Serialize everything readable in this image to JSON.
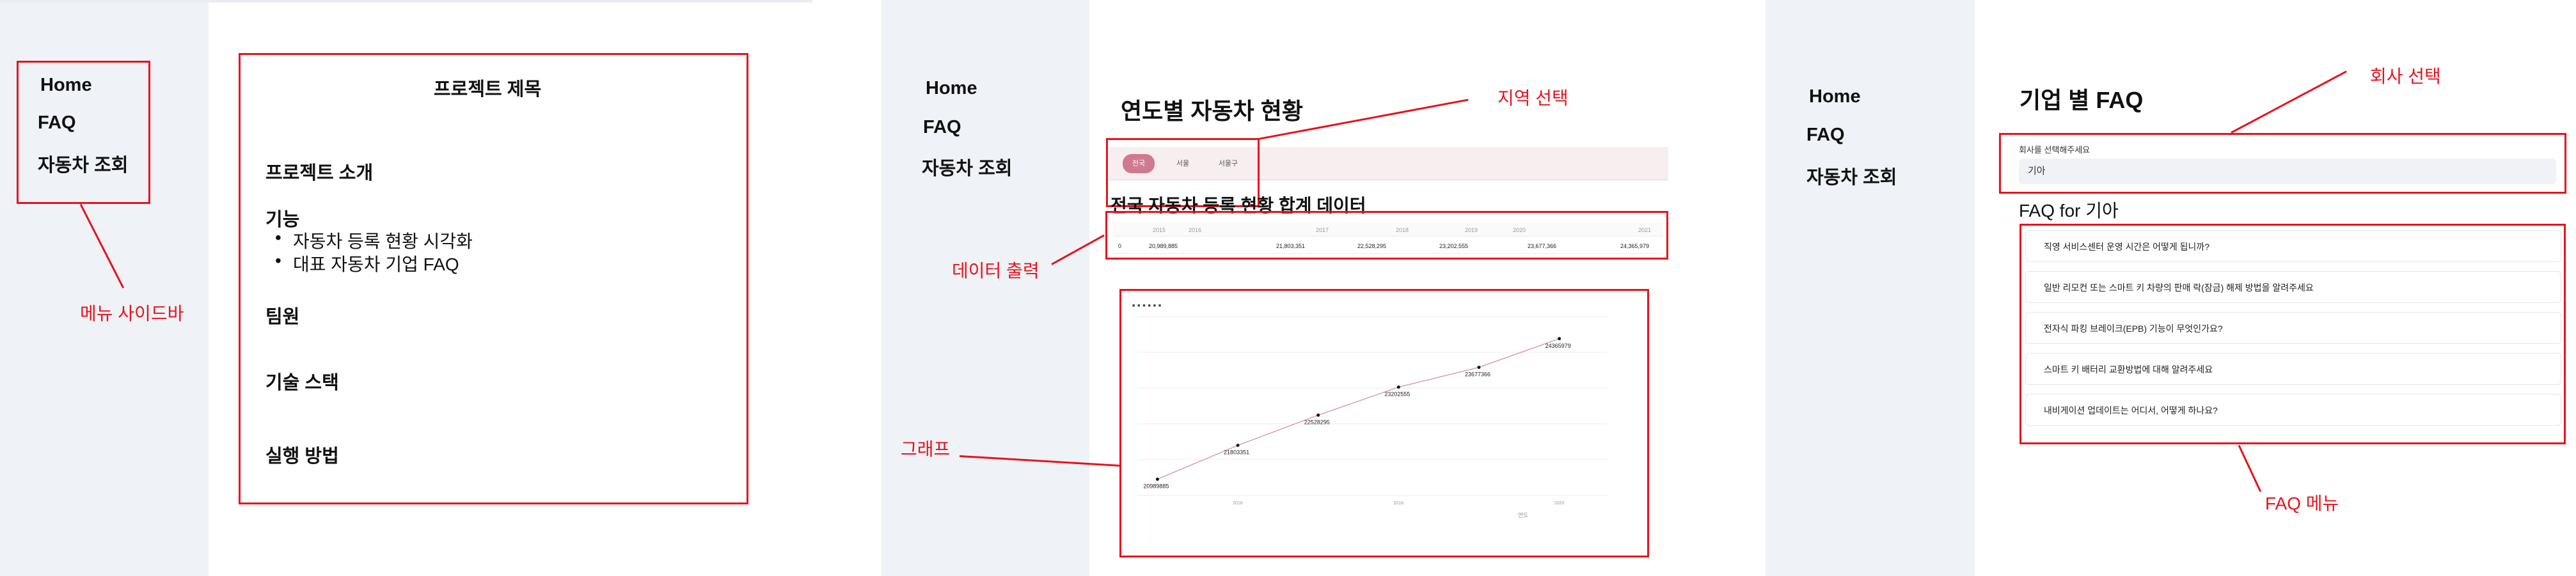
{
  "sidebar": {
    "items": [
      "Home",
      "FAQ",
      "자동차 조회"
    ]
  },
  "panel1": {
    "project_title": "프로젝트 제목",
    "intro": "프로젝트 소개",
    "features_heading": "기능",
    "features": [
      "자동차 등록 현황 시각화",
      "대표 자동차 기업 FAQ"
    ],
    "team": "팀원",
    "tech_stack": "기술 스택",
    "how_to_run": "실행 방법"
  },
  "panel2": {
    "title": "연도별 자동차 현황",
    "tabs": [
      "전국",
      "서울",
      "서울구"
    ],
    "table_title": "전국 자동차 등록 현황 합계 데이터",
    "table_headers": [
      "2015",
      "2016",
      "2017",
      "2018",
      "2019",
      "2020",
      "2021"
    ],
    "table_row_label": "0",
    "table_values": [
      "20,989,885",
      "21,803,351",
      "22,528,295",
      "23,202,555",
      "23,677,366",
      "24,365,979",
      ""
    ],
    "chart_title": "■ ■ ■ ■ ■ ■"
  },
  "panel3": {
    "title": "기업 별 FAQ",
    "select_label": "회사를 선택해주세요",
    "select_value": "기아",
    "faq_for_prefix": "FAQ for ",
    "faq_for_company": "기아",
    "faqs": [
      "직영 서비스센터 운영 시간은 어떻게 됩니까?",
      "일반 리모컨 또는 스마트 키 차량의 판매 락(잠금) 해제 방법을 알려주세요",
      "전자식 파킹 브레이크(EPB) 기능이 무엇인가요?",
      "스마트 키 배터리 교환방법에 대해 알려주세요",
      "내비게이션 업데이트는 어디서, 어떻게 하나요?"
    ]
  },
  "annotations": {
    "menu_sidebar": "메뉴 사이드바",
    "region_select": "지역 선택",
    "data_output": "데이터 출력",
    "graph": "그래프",
    "company_select": "회사 선택",
    "faq_menu": "FAQ 메뉴"
  },
  "colors": {
    "annotation_red": "#e8121c",
    "sidebar_bg": "#eff2f6",
    "tab_active": "#cf7a8f",
    "line_color": "#d9a0a6"
  },
  "chart_data": {
    "type": "line",
    "x": [
      2015,
      2016,
      2017,
      2018,
      2019,
      2020
    ],
    "series": [
      {
        "values": [
          20989885,
          21803351,
          22528295,
          23202555,
          23677366,
          24365979
        ]
      }
    ],
    "point_labels": [
      "20989885",
      "21803351",
      "22528295",
      "23202555",
      "23677366",
      "24365979"
    ],
    "x_ticks": [
      "2016",
      "2018",
      "2020"
    ],
    "xlabel": "연도",
    "ylim": [
      20600000,
      24900000
    ]
  }
}
